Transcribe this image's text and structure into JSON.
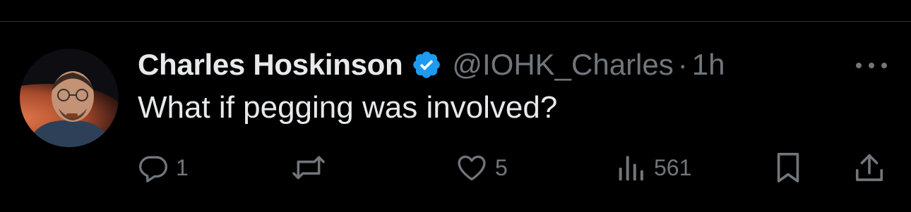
{
  "tweet": {
    "display_name": "Charles Hoskinson",
    "handle": "@IOHK_Charles",
    "separator": "·",
    "time": "1h",
    "text": "What if pegging was involved?",
    "verified": true
  },
  "actions": {
    "reply": {
      "icon": "reply-icon",
      "count": "1"
    },
    "retweet": {
      "icon": "retweet-icon",
      "count": ""
    },
    "like": {
      "icon": "heart-icon",
      "count": "5"
    },
    "views": {
      "icon": "views-icon",
      "count": "561"
    },
    "bookmark": {
      "icon": "bookmark-icon"
    },
    "share": {
      "icon": "share-icon"
    }
  },
  "colors": {
    "background": "#000000",
    "primary_text": "#e7e9ea",
    "secondary_text": "#71767b",
    "verified_blue": "#1d9bf0",
    "divider": "#2f3336"
  }
}
